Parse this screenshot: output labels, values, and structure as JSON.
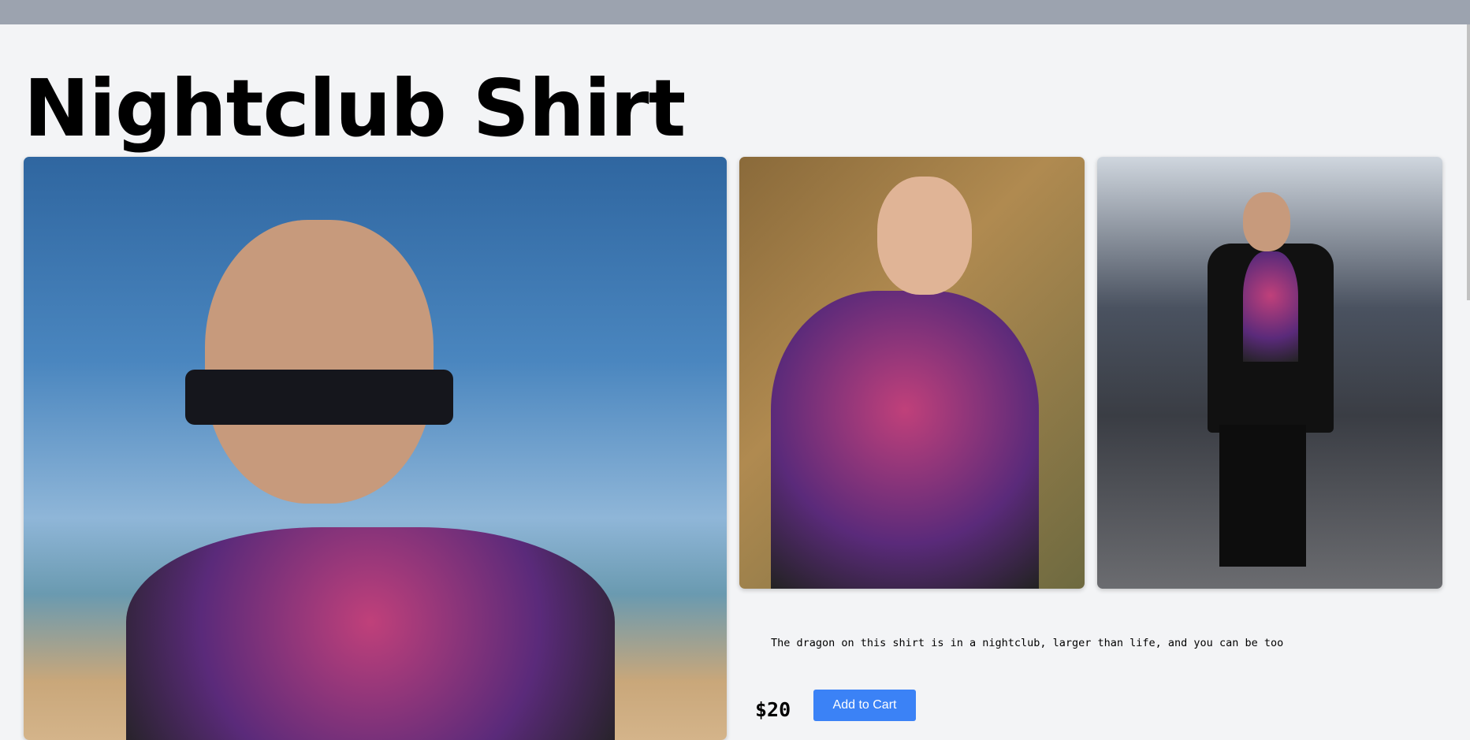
{
  "product": {
    "title": "Nightclub Shirt",
    "description": "The dragon on this shirt is in a nightclub, larger than life, and you can be too",
    "price": "$20",
    "add_to_cart_label": "Add to Cart"
  },
  "colors": {
    "accent": "#3b82f6",
    "topbar": "#9ca3af",
    "background": "#f3f4f6"
  }
}
